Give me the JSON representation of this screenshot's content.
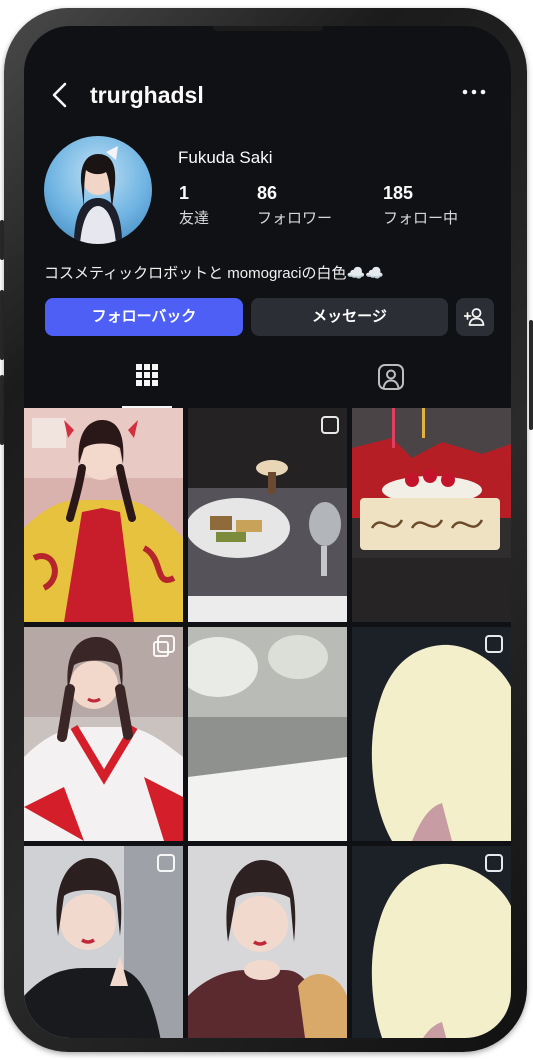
{
  "profile": {
    "username": "trurghadsl",
    "display_name": "Fukuda Saki",
    "bio": "コスメティックロボットと momograciの白色☁️☁️",
    "stats": [
      {
        "value": "1",
        "label": "友達"
      },
      {
        "value": "86",
        "label": "フォロワー"
      },
      {
        "value": "185",
        "label": "フォロー中"
      }
    ]
  },
  "actions": {
    "follow_back": "フォローバック",
    "message": "メッセージ"
  },
  "tabs": [
    "posts-grid",
    "tagged"
  ],
  "icons": {
    "back": "chevron-left-icon",
    "more": "more-horizontal-icon",
    "add_user": "add-user-icon",
    "grid": "grid-icon",
    "tagged": "tagged-user-icon"
  },
  "colors": {
    "background": "#0f1114",
    "primary_button": "#4d5ff5",
    "secondary_button": "#2b2e34",
    "text": "#fafafa"
  },
  "posts": [
    {
      "description": "girl in yellow kimono with braids",
      "badge": "none"
    },
    {
      "description": "dinner plate and glass",
      "badge": "single"
    },
    {
      "description": "birthday cake",
      "badge": "none"
    },
    {
      "description": "girl in shrine maiden outfit",
      "badge": "multi"
    },
    {
      "description": "white flowers bouquet",
      "badge": "none"
    },
    {
      "description": "white plush close-up",
      "badge": "single"
    },
    {
      "description": "girl selfie black outfit",
      "badge": "single"
    },
    {
      "description": "girl selfie hand on chin",
      "badge": "none"
    },
    {
      "description": "white plush close-up",
      "badge": "single"
    }
  ]
}
